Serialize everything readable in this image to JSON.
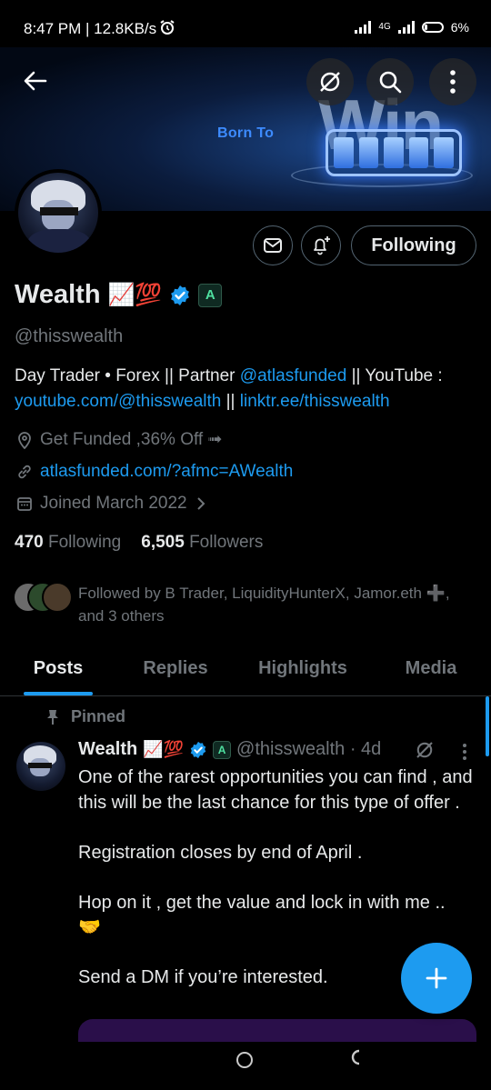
{
  "status_bar": {
    "time": "8:47 PM | 12.8KB/s",
    "network": "4G",
    "battery": "6%"
  },
  "banner": {
    "tagline": "Born To",
    "headline": "Win"
  },
  "header": {
    "icons": [
      "back-arrow-icon",
      "grok-icon",
      "search-icon",
      "more-vertical-icon"
    ]
  },
  "profile": {
    "name": "Wealth",
    "name_emojis": "📈💯",
    "affiliate_badge": "A",
    "handle": "@thisswealth",
    "bio_prefix": "Day Trader • Forex || Partner ",
    "bio_mention": "@atlasfunded",
    "bio_middle": " || YouTube : ",
    "bio_link1": "youtube.com/@thisswealth",
    "bio_sep": " || ",
    "bio_link2": "linktr.ee/thisswealth",
    "location": "Get Funded ,36% Off ➟",
    "website": "atlasfunded.com/?afmc=AWealth",
    "joined": "Joined March 2022",
    "following_count": "470",
    "following_label": "Following",
    "followers_count": "6,505",
    "followers_label": "Followers",
    "followed_by": "Followed by B Trader, LiquidityHunterX, Jamor.eth ➕, and 3 others"
  },
  "actions": {
    "follow_state": "Following"
  },
  "tabs": [
    {
      "label": "Posts",
      "active": true
    },
    {
      "label": "Replies",
      "active": false
    },
    {
      "label": "Highlights",
      "active": false
    },
    {
      "label": "Media",
      "active": false
    }
  ],
  "pinned_post": {
    "pinned_label": "Pinned",
    "author_name": "Wealth",
    "author_emojis": "📈💯",
    "badge": "A",
    "handle_time": "@thisswealth · 4d",
    "lines": [
      "One of the rarest opportunities you can find , and this will be the last chance for this type of offer .",
      "Registration closes by end of April .",
      "Hop on it , get the value and lock in with me ..",
      "🤝",
      "Send a DM if you’re interested."
    ]
  },
  "colors": {
    "accent": "#1d9bf0",
    "muted": "#71767b",
    "text": "#e7e9ea",
    "background": "#000000"
  }
}
